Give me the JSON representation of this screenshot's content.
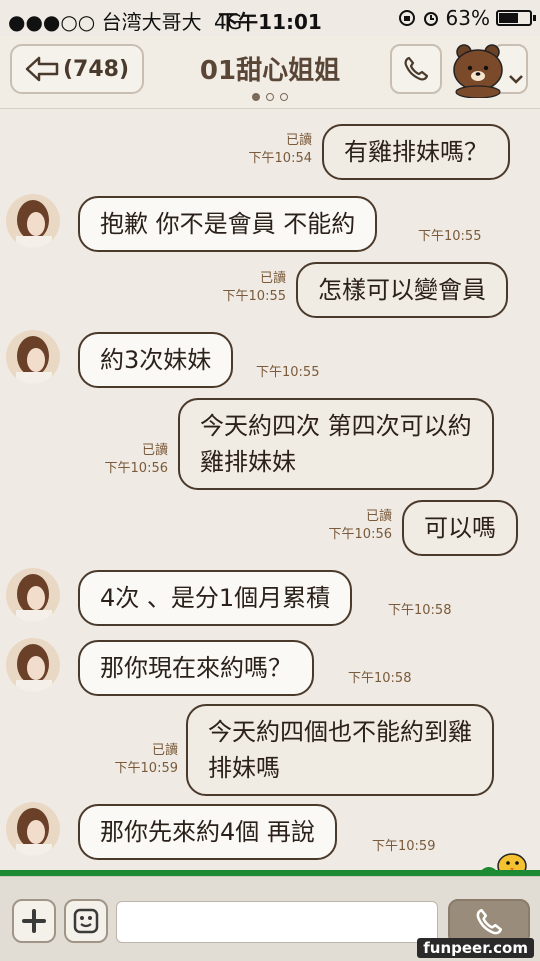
{
  "status_bar": {
    "signal": "●●●○○",
    "carrier": "台湾大哥大",
    "network": "4G",
    "time": "下午11:01",
    "battery_text": "63%",
    "battery_level": 0.63
  },
  "header": {
    "back_label": "(748)",
    "title": "01甜心姐姐",
    "page_dots": [
      true,
      false,
      false
    ],
    "icons": [
      "back-arrow-icon",
      "phone-icon",
      "bear-sticker-icon",
      "chevron-down-icon"
    ]
  },
  "messages": [
    {
      "side": "me",
      "lines": [
        "有雞排妹嗎？"
      ],
      "read": "已讀",
      "time": "下午10:54"
    },
    {
      "side": "other",
      "lines": [
        "抱歉 你不是會員 不能約"
      ],
      "time": "下午10:55"
    },
    {
      "side": "me",
      "lines": [
        "怎樣可以變會員"
      ],
      "read": "已讀",
      "time": "下午10:55"
    },
    {
      "side": "other",
      "lines": [
        "約3次妹妹"
      ],
      "time": "下午10:55"
    },
    {
      "side": "me",
      "lines": [
        "今天約四次 第四次可以約",
        "雞排妹妹"
      ],
      "read": "已讀",
      "time": "下午10:56"
    },
    {
      "side": "me",
      "lines": [
        "可以嗎"
      ],
      "read": "已讀",
      "time": "下午10:56"
    },
    {
      "side": "other",
      "lines": [
        "4次 、是分1個月累積"
      ],
      "time": "下午10:58"
    },
    {
      "side": "other",
      "lines": [
        "那你現在來約嗎？"
      ],
      "time": "下午10:58"
    },
    {
      "side": "me",
      "lines": [
        "今天約四個也不能約到雞",
        "排妹嗎"
      ],
      "read": "已讀",
      "time": "下午10:59"
    },
    {
      "side": "other",
      "lines": [
        "那你先來約4個 再說"
      ],
      "time": "下午10:59"
    }
  ],
  "input_bar": {
    "icons": [
      "plus-icon",
      "emoticon-icon",
      "phone-icon"
    ],
    "input_value": ""
  },
  "watermark": "funpeer.com",
  "colors": {
    "background": "#efebe4",
    "bubble_border": "#4a3a2c",
    "timestamp": "#7a5a3a"
  }
}
